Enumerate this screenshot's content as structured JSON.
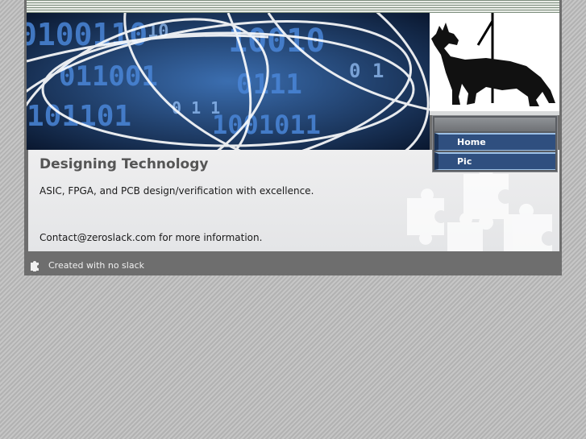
{
  "content": {
    "title": "Designing Technology",
    "paragraph_1": "ASIC, FPGA, and PCB design/verification with excellence.",
    "paragraph_2": "Contact@zeroslack.com for more information."
  },
  "nav": {
    "items": [
      {
        "label": "Home"
      },
      {
        "label": "Pic"
      }
    ]
  },
  "footer": {
    "text": "Created with no slack"
  },
  "icons": {
    "footer": "puzzle-piece-icon",
    "decoration": "puzzle-pieces-background"
  },
  "images": {
    "banner": "binary-digits-with-curves-banner",
    "dog": "german-shepherd-silhouette"
  },
  "colors": {
    "nav_item": "#2f4f7f",
    "nav_border": "#9cc0e6",
    "title": "#555555",
    "footer": "#6e6e6e"
  }
}
